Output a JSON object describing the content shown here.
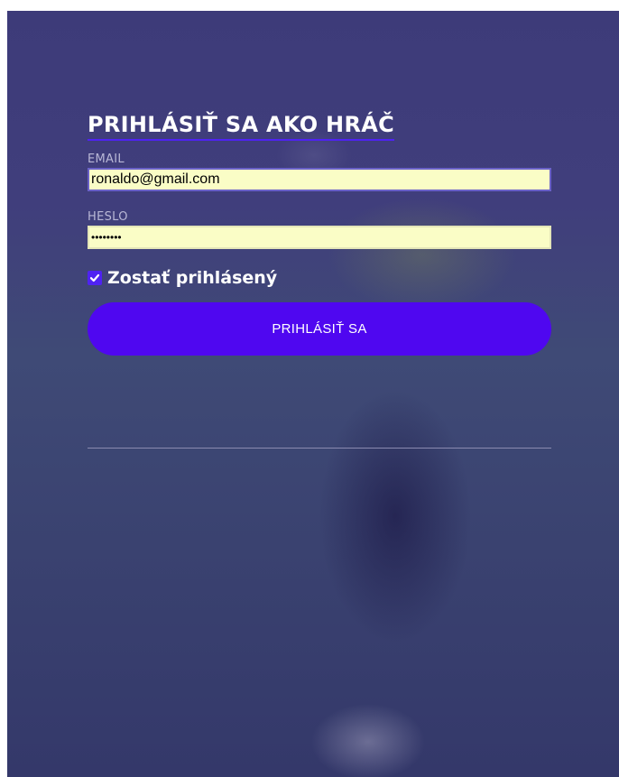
{
  "login": {
    "title": "PRIHLÁSIŤ SA AKO HRÁČ",
    "email_label": "EMAIL",
    "email_value": "ronaldo@gmail.com",
    "password_label": "HESLO",
    "password_value": "••••••••",
    "remember_label": "Zostať prihlásený",
    "remember_checked": true,
    "submit_label": "PRIHLÁSIŤ SA"
  },
  "colors": {
    "accent": "#4f07f0",
    "overlay": "#3d3b79",
    "autofill": "#fafdc6"
  },
  "icons": {
    "checkbox": "check-icon"
  }
}
